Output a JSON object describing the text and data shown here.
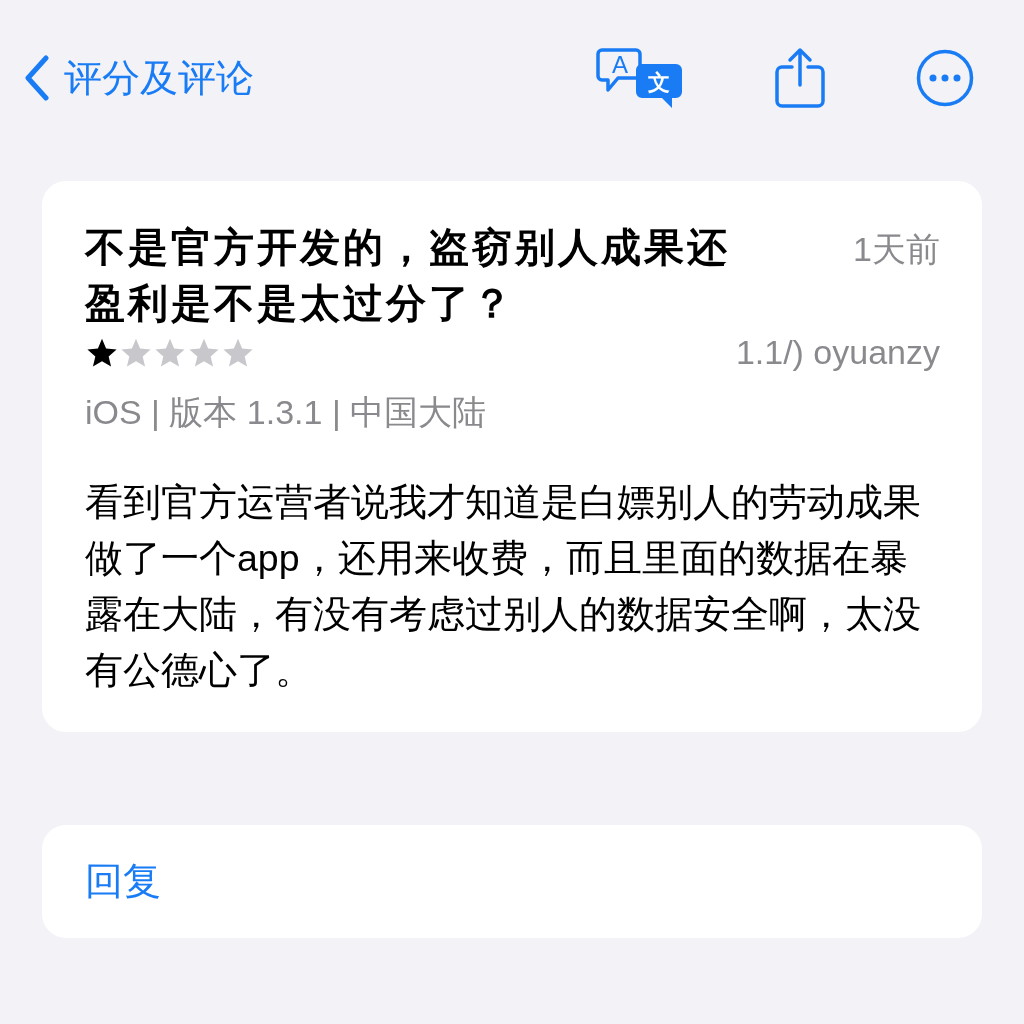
{
  "nav": {
    "back_label": "评分及评论",
    "translate_icon": {
      "source_glyph": "A",
      "target_glyph": "文"
    }
  },
  "review": {
    "title": "不是官方开发的，盗窃别人成果还盈利是不是太过分了？",
    "date": "1天前",
    "stars": 1,
    "author": "1.1/) oyuanzy",
    "meta": "iOS | 版本 1.3.1 | 中国大陆",
    "body": "看到官方运营者说我才知道是白嫖别人的劳动成果做了一个app，还用来收费，而且里面的数据在暴露在大陆，有没有考虑过别人的数据安全啊，太没有公德心了。"
  },
  "reply": {
    "label": "回复"
  }
}
